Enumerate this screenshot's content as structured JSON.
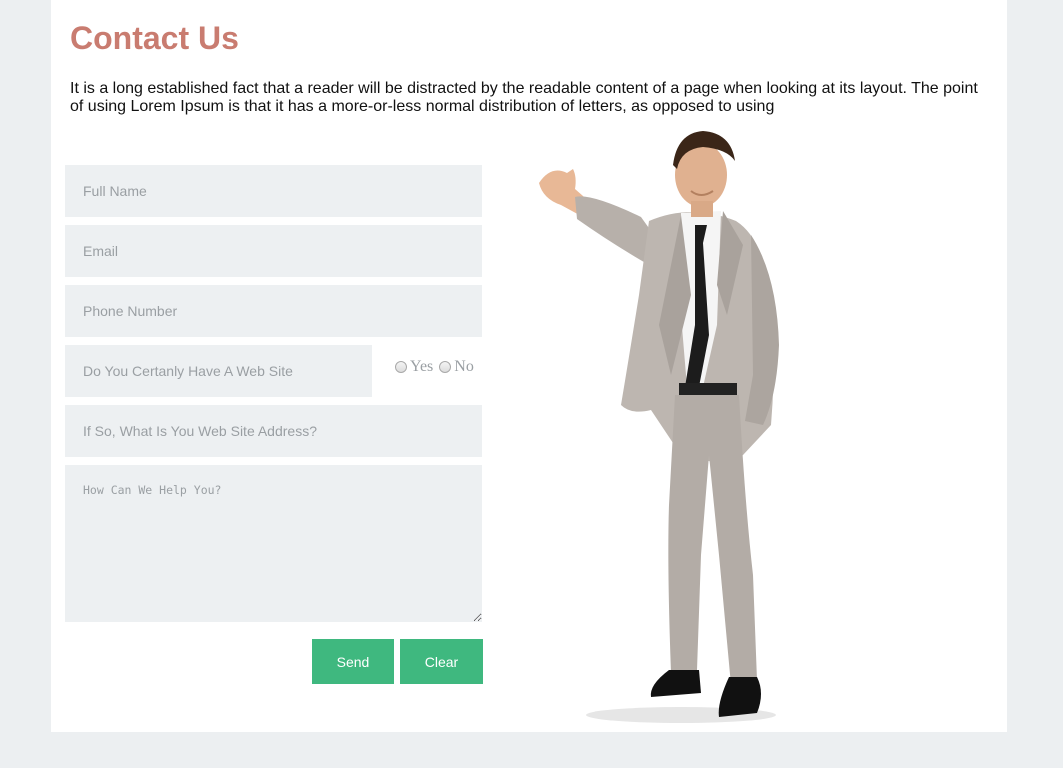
{
  "header": {
    "title": "Contact Us",
    "intro": "It is a long established fact that a reader will be distracted by the readable content of a page when looking at its layout. The point of using Lorem Ipsum is that it has a more-or-less normal distribution of letters, as opposed to using"
  },
  "form": {
    "full_name_placeholder": "Full Name",
    "email_placeholder": "Email",
    "phone_placeholder": "Phone Number",
    "website_question_placeholder": "Do You Certanly Have A Web Site",
    "website_yes_label": "Yes",
    "website_no_label": "No",
    "website_address_placeholder": "If So, What Is You Web Site Address?",
    "help_placeholder": "How Can We Help You?",
    "send_label": "Send",
    "clear_label": "Clear"
  },
  "colors": {
    "title": "#c97c70",
    "button": "#3fb87f",
    "field_bg": "#edf0f2",
    "page_bg": "#eceff1"
  },
  "image": {
    "description_icon": "businessman-presenting-illustration"
  }
}
